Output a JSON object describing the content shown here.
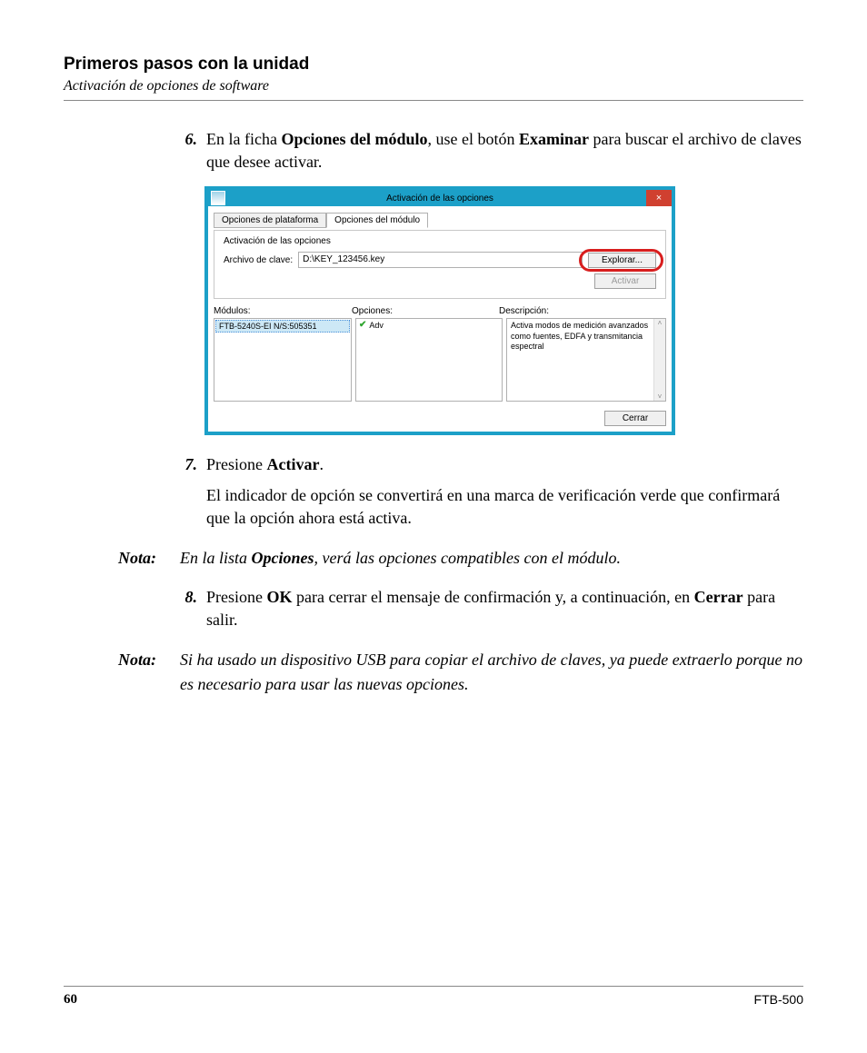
{
  "header": {
    "title": "Primeros pasos con la unidad",
    "subtitle": "Activación de opciones de software"
  },
  "steps": {
    "s6": {
      "num": "6.",
      "pre": "En la ficha ",
      "b1": "Opciones del módulo",
      "mid1": ", use el botón ",
      "b2": "Examinar",
      "post": " para buscar el archivo de claves que desee activar."
    },
    "s7": {
      "num": "7.",
      "t1a": "Presione ",
      "t1b": "Activar",
      "t1c": ".",
      "t2": "El indicador de opción se convertirá en una marca de verificación verde que confirmará que la opción ahora está activa."
    },
    "s8": {
      "num": "8.",
      "pre": "Presione ",
      "b1": "OK",
      "mid": " para cerrar el mensaje de confirmación y, a continuación, en ",
      "b2": "Cerrar",
      "post": " para salir."
    }
  },
  "notes": {
    "label": "Nota:",
    "n1a": "En la lista ",
    "n1b": "Opciones",
    "n1c": ", verá las opciones compatibles con el módulo.",
    "n2": "Si ha usado un dispositivo USB para copiar el archivo de claves, ya puede extraerlo porque no es necesario para usar las nuevas opciones."
  },
  "dialog": {
    "title": "Activación de las opciones",
    "close_x": "×",
    "tabs": {
      "platform": "Opciones de plataforma",
      "module": "Opciones del módulo"
    },
    "group_title": "Activación de las opciones",
    "key_label": "Archivo de clave:",
    "key_value": "D:\\KEY_123456.key",
    "browse": "Explorar...",
    "activate": "Activar",
    "cols": {
      "modules": "Módulos:",
      "options": "Opciones:",
      "desc": "Descripción:"
    },
    "module_item": "FTB-5240S-EI N/S:505351",
    "option_item": "Adv",
    "description": "Activa modos de medición avanzados como fuentes, EDFA y transmitancia espectral",
    "close_btn": "Cerrar",
    "scroll_up": "˄",
    "scroll_down": "˅"
  },
  "footer": {
    "page": "60",
    "model": "FTB-500"
  }
}
